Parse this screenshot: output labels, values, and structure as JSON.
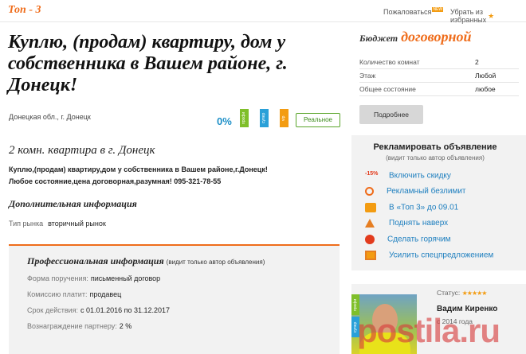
{
  "topbar": {
    "badge": "Топ - 3",
    "complain_label": "Пожаловаться",
    "new_badge": "NEW",
    "unfavorite_label": "Убрать из избранных",
    "star_glyph": "★"
  },
  "listing": {
    "title": "Куплю, (продам) квартиру, дом у собственника в Вашем районе, г. Донецк!",
    "location": "Донецкая обл., г. Донецк",
    "percent": "0%",
    "tags": [
      "профи",
      "супер",
      "vip"
    ],
    "real_label": "Реальное",
    "subtitle": "2 комн. квартира в г. Донецк",
    "description_1": "Куплю,(продам) квартиру,дом у собственника в Вашем районе,г.Донецк!",
    "description_2": "Любое состояние,цена договорная,разумная! 095-321-78-55",
    "additional_heading": "Дополнительная информация",
    "market_label": "Тип рынка",
    "market_value": "вторичный рынок"
  },
  "professional": {
    "title": "Профессиональная информация",
    "note": "(видит только автор объявления)",
    "rows": [
      {
        "label": "Форма поручения:",
        "value": "письменный договор"
      },
      {
        "label": "Комиссию платит:",
        "value": "продавец"
      },
      {
        "label": "Срок действия:",
        "value": "с 01.01.2016 по 31.12.2017"
      },
      {
        "label": "Вознаграждение партнеру:",
        "value": "2 %"
      }
    ]
  },
  "sidebar": {
    "budget_label": "Бюджет",
    "budget_value": "договорной",
    "specs": [
      {
        "label": "Количество комнат",
        "value": "2"
      },
      {
        "label": "Этаж",
        "value": "Любой"
      },
      {
        "label": "Общее состояние",
        "value": "любое"
      }
    ],
    "more_button": "Подробнее",
    "promo_title": "Рекламировать объявление",
    "promo_sub": "(видит только автор объявления)",
    "promo_items": [
      {
        "icon": "discount-icon",
        "icon_text": "-15%",
        "label": "Включить скидку"
      },
      {
        "icon": "infinity-icon",
        "icon_text": "",
        "label": "Рекламный безлимит"
      },
      {
        "icon": "tag-icon",
        "icon_text": "",
        "label": "В «Топ 3» до 09.01"
      },
      {
        "icon": "arrow-up-icon",
        "icon_text": "",
        "label": "Поднять наверх"
      },
      {
        "icon": "fire-icon",
        "icon_text": "",
        "label": "Сделать горячим"
      },
      {
        "icon": "special-offer-icon",
        "icon_text": "",
        "label": "Усилить спецпредложением"
      }
    ],
    "agent_status_label": "Статус:",
    "agent_stars": "★★★★★",
    "agent_name": "Вадим Киренко",
    "agent_since": "с 2014 года",
    "agent_tags": [
      "профи",
      "супер"
    ]
  },
  "watermark": "postila.ru",
  "colors": {
    "accent": "#ef6c1a",
    "link": "#1e7fbf",
    "panel": "#f2f2f2"
  }
}
